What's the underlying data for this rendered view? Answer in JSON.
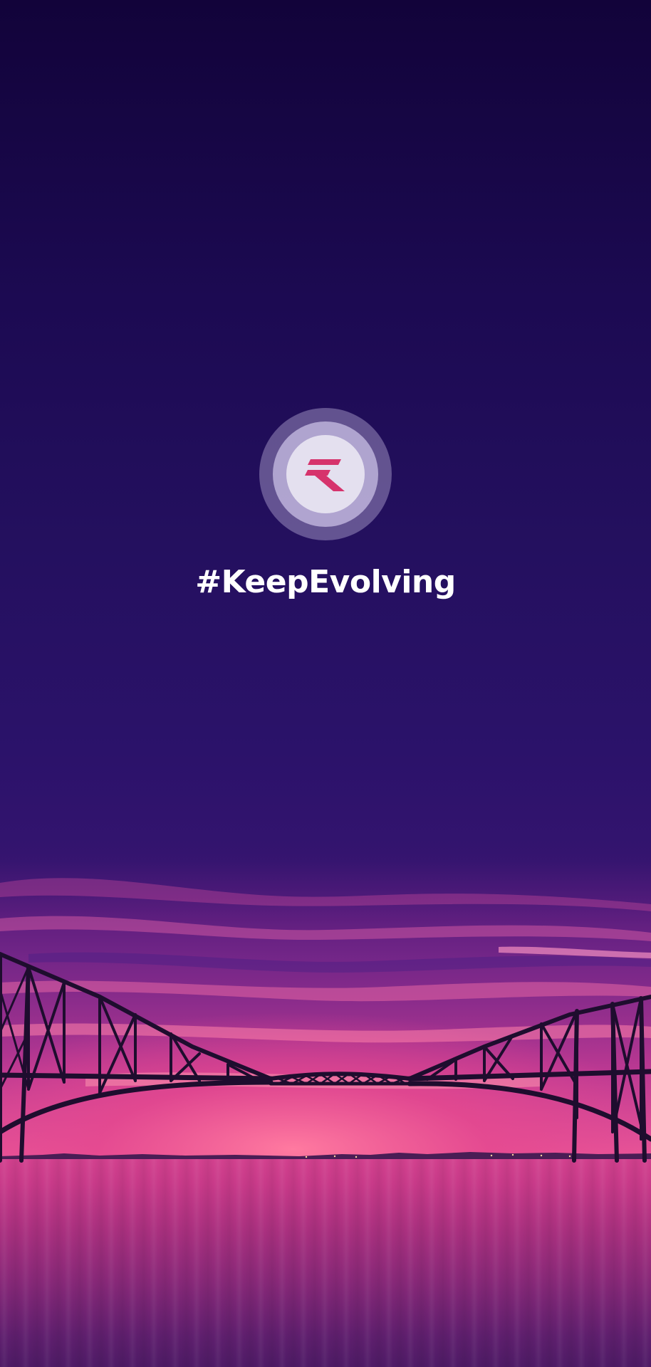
{
  "splash": {
    "tagline": "#KeepEvolving",
    "logo_icon": "brand-logo-icon",
    "background": "forth-bridge-sunset-photo"
  },
  "colors": {
    "brand_pink": "#d6336c",
    "ring_light": "#e4e0ef",
    "sky_top": "#12033a",
    "sky_mid": "#2b126a",
    "water": "#c83a89"
  }
}
